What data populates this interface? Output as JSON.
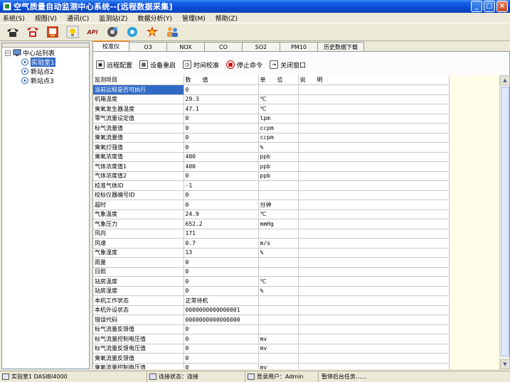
{
  "window": {
    "title": "空气质量自动监测中心系统--[远程数据采集]",
    "buttons": {
      "minimize": "_",
      "maximize": "□",
      "close": "×"
    }
  },
  "menu": [
    "系统(S)",
    "视图(V)",
    "通讯(C)",
    "监测站(Z)",
    "数据分析(Y)",
    "管理(M)",
    "帮助(Z)"
  ],
  "toolbar": {
    "icons": [
      "telephone-icon",
      "hangup-phone-icon",
      "monitor-icon",
      "lightbulb-icon",
      "api-icon",
      "gear-person-icon",
      "network-gear-icon",
      "alarm-icon",
      "users-icon"
    ],
    "api_label": "API"
  },
  "tree": {
    "root": "中心站列表",
    "expander": "−",
    "children": [
      "实验室1",
      "新站点2",
      "新站点3"
    ],
    "selected_index": 0
  },
  "tabs": [
    "校准仪",
    "O3",
    "NOX",
    "CO",
    "SO2",
    "PM10",
    "历史数据下载"
  ],
  "active_tab": 0,
  "commands": [
    {
      "label": "远程配置",
      "icon": "remote-config-icon"
    },
    {
      "label": "设备重启",
      "icon": "device-restart-icon"
    },
    {
      "label": "时间校准",
      "icon": "time-calibrate-icon"
    },
    {
      "label": "停止命令",
      "icon": "stop-command-icon"
    },
    {
      "label": "关闭窗口",
      "icon": "close-window-icon"
    }
  ],
  "grid": {
    "headers": [
      "监测项目",
      "数　　值",
      "单　　位",
      "说　　明"
    ],
    "rows": [
      [
        "当前远程是否可执行",
        "0",
        "",
        ""
      ],
      [
        "机箱温度",
        "29.3",
        "℃",
        ""
      ],
      [
        "臭氧发生器温度",
        "47.1",
        "℃",
        ""
      ],
      [
        "零气流量设定值",
        "0",
        "lpm",
        ""
      ],
      [
        "标气流量值",
        "0",
        "ccpm",
        ""
      ],
      [
        "臭氧流量值",
        "0",
        "ccpm",
        ""
      ],
      [
        "臭氧灯强值",
        "0",
        "%",
        ""
      ],
      [
        "臭氧浓度值",
        "400",
        "ppb",
        ""
      ],
      [
        "气体浓度值1",
        "400",
        "ppb",
        ""
      ],
      [
        "气体浓度值2",
        "0",
        "ppb",
        ""
      ],
      [
        "校准气体ID",
        "-1",
        "",
        ""
      ],
      [
        "校标仪器编号ID",
        "0",
        "",
        ""
      ],
      [
        "超时",
        "0",
        "分钟",
        ""
      ],
      [
        "气象温度",
        "24.9",
        "℃",
        ""
      ],
      [
        "气象压力",
        "652.2",
        "mmHg",
        ""
      ],
      [
        "风向",
        "171",
        "",
        ""
      ],
      [
        "风速",
        "0.7",
        "m/s",
        ""
      ],
      [
        "气象湿度",
        "13",
        "%",
        ""
      ],
      [
        "雨量",
        "0",
        "",
        ""
      ],
      [
        "日照",
        "0",
        "",
        ""
      ],
      [
        "站房温度",
        "0",
        "℃",
        ""
      ],
      [
        "站房湿度",
        "0",
        "%",
        ""
      ],
      [
        "本机工作状态",
        "正常待机",
        "",
        ""
      ],
      [
        "本机外设状态",
        "0000000000000001",
        "",
        ""
      ],
      [
        "错误代码",
        "0000000000000000",
        "",
        ""
      ],
      [
        "标气流量反馈值",
        "0",
        "",
        ""
      ],
      [
        "标气流量控制电压值",
        "0",
        "mv",
        ""
      ],
      [
        "标气流量反馈电压值",
        "0",
        "mv",
        ""
      ],
      [
        "臭氧流量反馈值",
        "0",
        "",
        ""
      ],
      [
        "臭氧流量控制电压值",
        "0",
        "mv",
        ""
      ]
    ],
    "selected_row": 0
  },
  "scrollbar": {
    "up": "▲",
    "down": "▼"
  },
  "status": {
    "station": "实验室1   DASIBI4000",
    "connection": "连接状态：连接",
    "user": "登录用户：Admin",
    "task": "暂停后台任务......"
  }
}
